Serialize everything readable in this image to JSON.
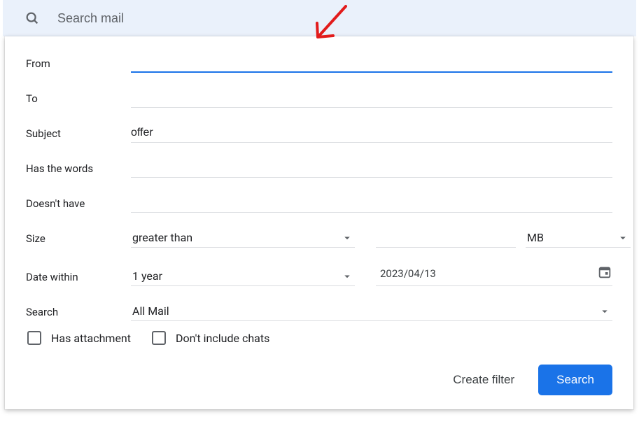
{
  "search": {
    "placeholder": "Search mail"
  },
  "form": {
    "from_label": "From",
    "from_value": "",
    "to_label": "To",
    "to_value": "",
    "subject_label": "Subject",
    "subject_value": "offer",
    "haswords_label": "Has the words",
    "haswords_value": "",
    "nothave_label": "Doesn't have",
    "nothave_value": "",
    "size_label": "Size",
    "size_operator": "greater than",
    "size_value": "",
    "size_unit": "MB",
    "date_label": "Date within",
    "date_range": "1 year",
    "date_value": "2023/04/13",
    "search_label": "Search",
    "search_scope": "All Mail"
  },
  "checkboxes": {
    "attachment": "Has attachment",
    "exclude_chats": "Don't include chats"
  },
  "actions": {
    "create_filter": "Create filter",
    "search": "Search"
  }
}
